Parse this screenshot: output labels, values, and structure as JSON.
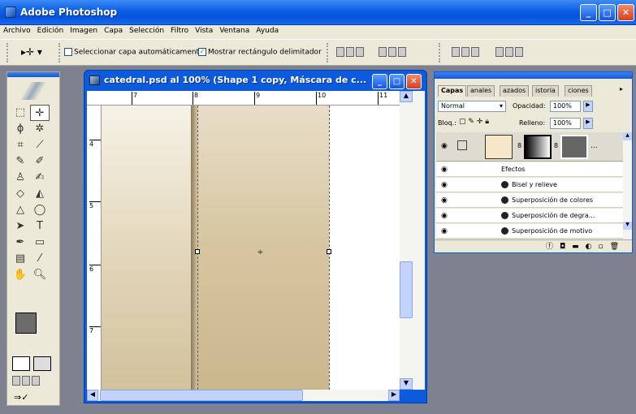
{
  "app": {
    "title": "Adobe Photoshop"
  },
  "window_controls": {
    "minimize": "_",
    "maximize": "□",
    "close": "✕"
  },
  "menu": [
    "Archivo",
    "Edición",
    "Imagen",
    "Capa",
    "Selección",
    "Filtro",
    "Vista",
    "Ventana",
    "Ayuda"
  ],
  "options": {
    "auto_select_label": "Seleccionar capa automáticamente",
    "auto_select_checked": false,
    "show_bbox_label": "Mostrar rectángulo delimitador",
    "show_bbox_checked": true
  },
  "document": {
    "title": "catedral.psd al 100% (Shape 1 copy, Máscara de c...",
    "ruler_h": [
      "7",
      "8",
      "9",
      "10",
      "11"
    ],
    "ruler_v": [
      "4",
      "5",
      "6",
      "7"
    ]
  },
  "layers_panel": {
    "tabs": [
      "Capas",
      "Canales",
      "Trazados",
      "Historia",
      "Acciones"
    ],
    "tabs_visible": [
      "Capas",
      "anales",
      "azados",
      "istoria",
      "ciones"
    ],
    "blend_mode": "Normal",
    "opacity_label": "Opacidad:",
    "opacity_value": "100%",
    "lock_label": "Bloq.:",
    "fill_label": "Relleno:",
    "fill_value": "100%",
    "effects_label": "Efectos",
    "effects": [
      "Bisel y relieve",
      "Superposición de colores",
      "Superposición de degra...",
      "Superposición de motivo"
    ],
    "layer_more": "..."
  },
  "colors": {
    "titlebar": "#0a5ee6",
    "chrome": "#ece9d8",
    "workspace": "#7e8190",
    "canvas_tan": "#d8c6a2"
  },
  "icons": [
    "move-tool-icon",
    "marquee-icon",
    "lasso-icon",
    "magic-wand-icon",
    "crop-icon",
    "slice-icon",
    "healing-icon",
    "brush-icon",
    "stamp-icon",
    "history-brush-icon",
    "eraser-icon",
    "bucket-icon",
    "blur-icon",
    "dodge-icon",
    "path-select-icon",
    "type-icon",
    "pen-icon",
    "shape-icon",
    "notes-icon",
    "eyedropper-icon",
    "hand-icon",
    "zoom-icon"
  ]
}
